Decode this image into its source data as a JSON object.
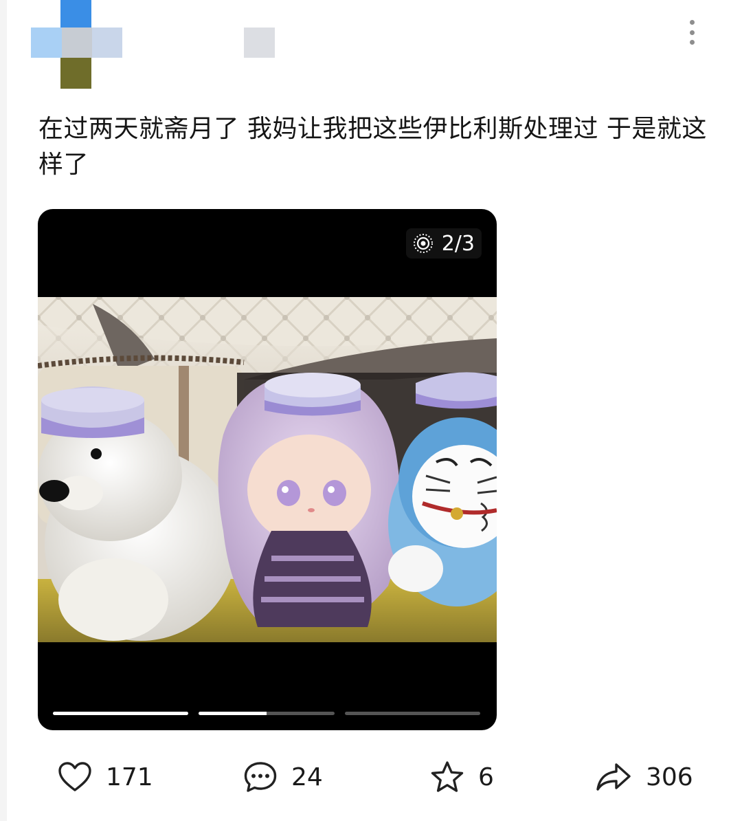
{
  "post": {
    "text": "在过两天就斋月了 我妈让我把这些伊比利斯处理过 于是就这样了"
  },
  "header": {
    "avatar_icon": "pixelated-avatar-icon",
    "menu_icon": "more-vertical-icon"
  },
  "media": {
    "counter": "2/3",
    "counter_icon": "live-photo-icon",
    "progress_fill": [
      1.0,
      0.5,
      0.0
    ],
    "photo_description_icon": "photo"
  },
  "actions": {
    "like_count": "171",
    "comment_count": "24",
    "favorite_count": "6",
    "share_count": "306"
  },
  "colors": {
    "media_background": "#000000",
    "icon_stroke": "#222222",
    "menu_dots": "#8e8e8e"
  }
}
